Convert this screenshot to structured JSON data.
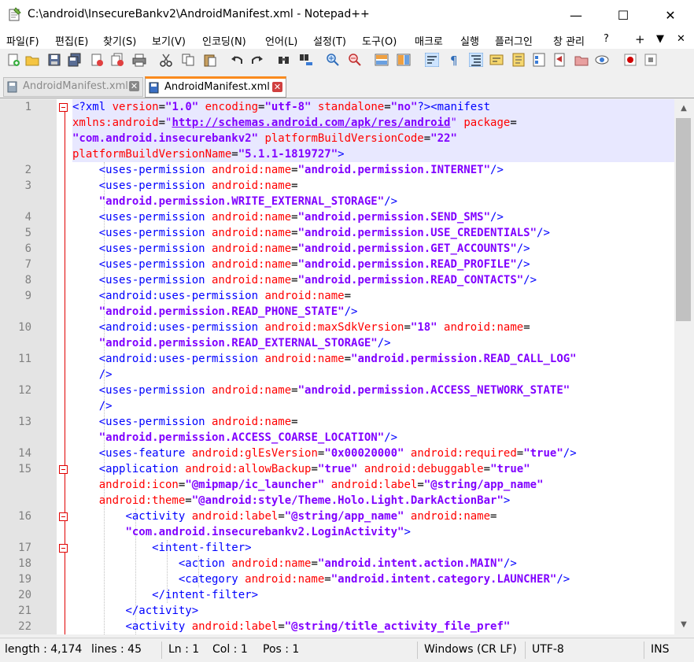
{
  "window": {
    "title": "C:\\android\\InsecureBankv2\\AndroidManifest.xml - Notepad++",
    "minimize": "—",
    "maximize": "☐",
    "close": "✕"
  },
  "menu": [
    "파일(F)",
    "편집(E)",
    "찾기(S)",
    "보기(V)",
    "인코딩(N)",
    "언어(L)",
    "설정(T)",
    "도구(O)",
    "매크로",
    "실행",
    "플러그인",
    "창 관리",
    "?"
  ],
  "menu_right": {
    "plus": "+",
    "down": "▼",
    "close": "✕"
  },
  "tabs": [
    {
      "label": "AndroidManifest.xml",
      "close": "✕"
    },
    {
      "label": "AndroidManifest.xml",
      "close": "✕"
    }
  ],
  "line_numbers": [
    "1",
    "2",
    "3",
    "4",
    "5",
    "6",
    "7",
    "8",
    "9",
    "10",
    "11",
    "12",
    "13",
    "14",
    "15",
    "16",
    "17",
    "18",
    "19",
    "20",
    "21",
    "22"
  ],
  "status": {
    "length": "length : 4,174",
    "lines": "lines : 45",
    "ln": "Ln : 1",
    "col": "Col : 1",
    "pos": "Pos : 1",
    "eol": "Windows (CR LF)",
    "encoding": "UTF-8",
    "mode": "INS"
  },
  "colors": {
    "tag": "#0000ff",
    "attr": "#ff0000",
    "value": "#8000ff",
    "active_tab_accent": "#fa8b1e",
    "current_line": "#e8e8ff"
  }
}
